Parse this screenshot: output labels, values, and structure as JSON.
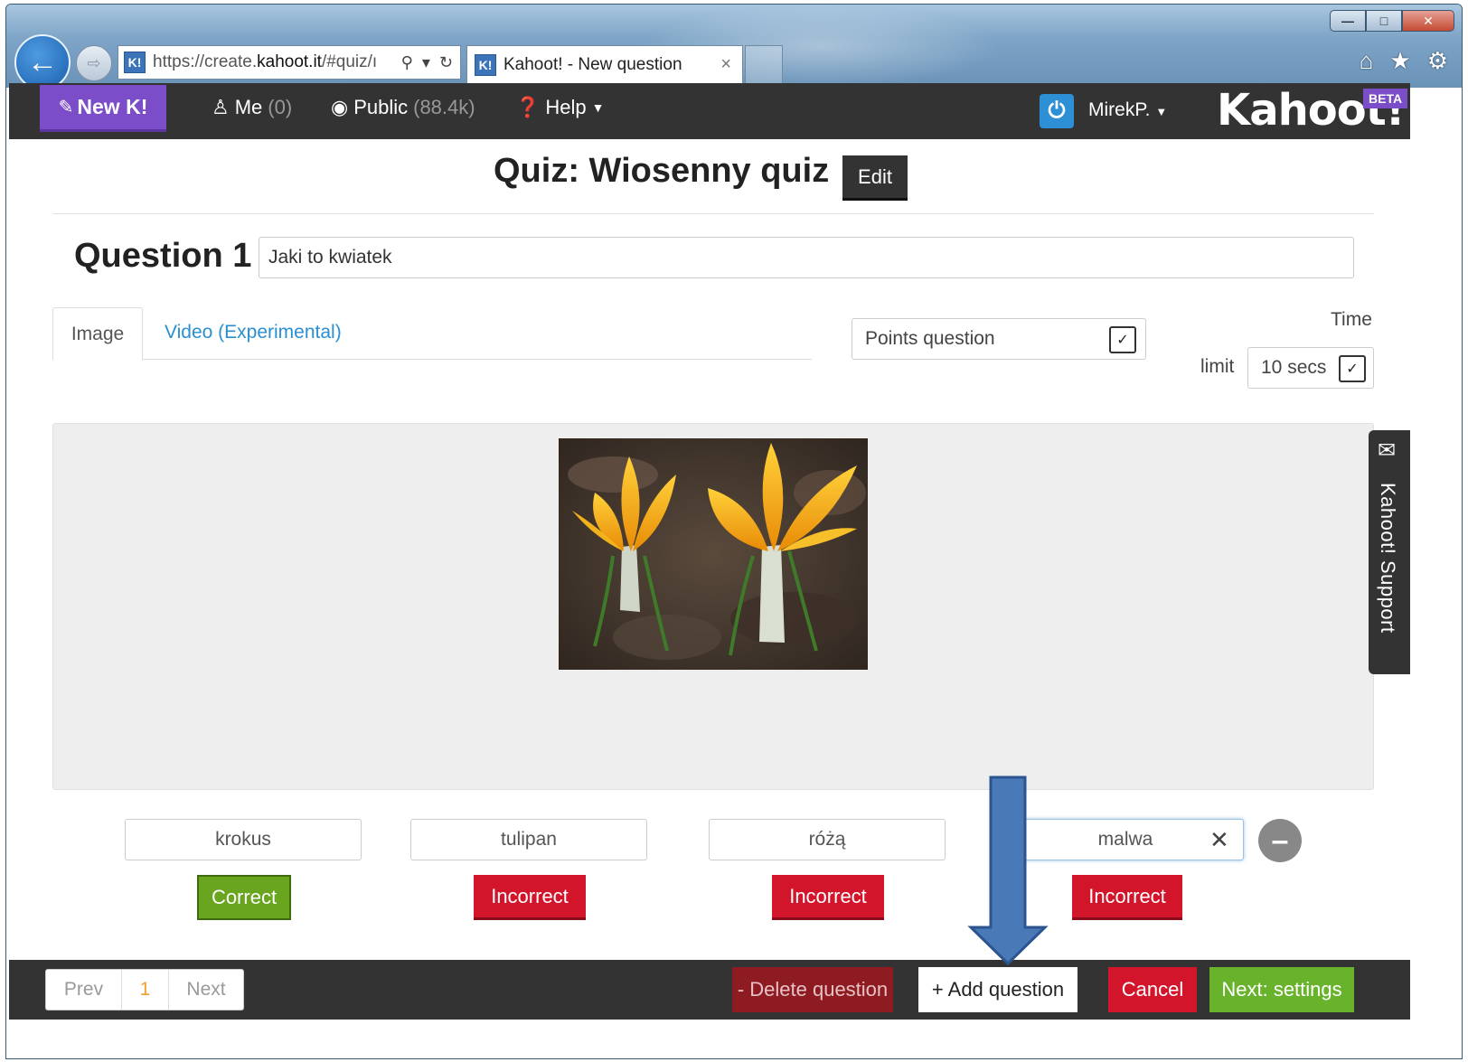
{
  "browser": {
    "url_prefix": "https://create.",
    "url_host": "kahoot.it",
    "url_rest": "/#quiz/ı",
    "favicon": "K!",
    "tab_title": "Kahoot! - New question",
    "tab_close": "×"
  },
  "nav": {
    "new_k": "New K!",
    "me_label": "Me",
    "me_count": "(0)",
    "public_label": "Public",
    "public_count": "(88.4k)",
    "help_label": "Help",
    "user": "MirekP.",
    "logo": "Kahoot!",
    "beta": "BETA"
  },
  "quiz": {
    "title": "Quiz: Wiosenny quiz",
    "edit_label": "Edit"
  },
  "question": {
    "label": "Question 1",
    "text": "Jaki to kwiatek"
  },
  "media_tabs": {
    "image": "Image",
    "video": "Video (Experimental)"
  },
  "question_type": {
    "selected": "Points question"
  },
  "time_limit": {
    "label_time": "Time",
    "label_limit": "limit",
    "selected": "10 secs"
  },
  "support": {
    "label": "Kahoot! Support"
  },
  "answers": [
    {
      "text": "krokus",
      "status": "Correct"
    },
    {
      "text": "tulipan",
      "status": "Incorrect"
    },
    {
      "text": "różą",
      "status": "Incorrect"
    },
    {
      "text": "malwa",
      "status": "Incorrect"
    }
  ],
  "pager": {
    "prev": "Prev",
    "current": "1",
    "next": "Next"
  },
  "actions": {
    "delete": "- Delete question",
    "add": "+ Add question",
    "cancel": "Cancel",
    "next_settings": "Next: settings"
  },
  "colors": {
    "kahoot_purple": "#7c4dc8",
    "correct_green": "#69a51f",
    "incorrect_red": "#d3152c",
    "nav_dark": "#333333",
    "link_blue": "#2a8fd1"
  }
}
